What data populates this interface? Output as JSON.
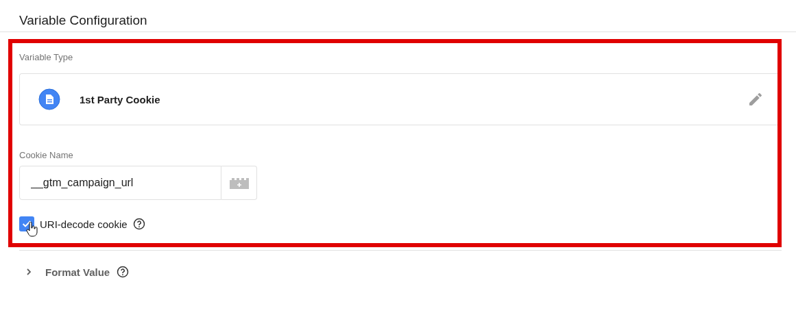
{
  "panel": {
    "title": "Variable Configuration"
  },
  "variable_type": {
    "label": "Variable Type",
    "name": "1st Party Cookie"
  },
  "cookie_name": {
    "label": "Cookie Name",
    "value": "__gtm_campaign_url"
  },
  "uri_decode": {
    "label": "URI-decode cookie",
    "checked": true
  },
  "format_value": {
    "label": "Format Value",
    "expanded": false
  }
}
